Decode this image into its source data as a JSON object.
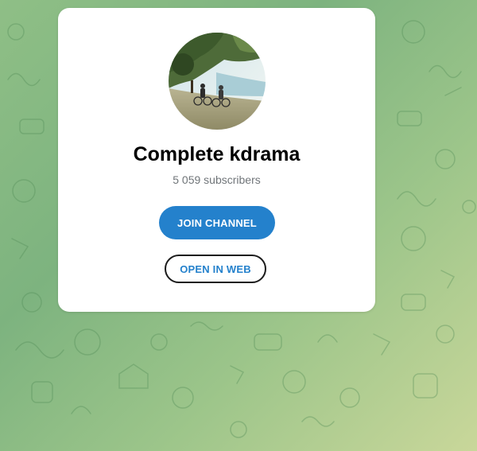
{
  "channel": {
    "name": "Complete kdrama",
    "subscribers": "5 059 subscribers",
    "avatar_icon": "channel-avatar-photo"
  },
  "actions": {
    "join_label": "JOIN CHANNEL",
    "open_web_label": "OPEN IN WEB"
  },
  "colors": {
    "accent": "#2481cc",
    "subtitle": "#707579",
    "background_green": "#7db37f",
    "background_yellow": "#c9d79a"
  }
}
